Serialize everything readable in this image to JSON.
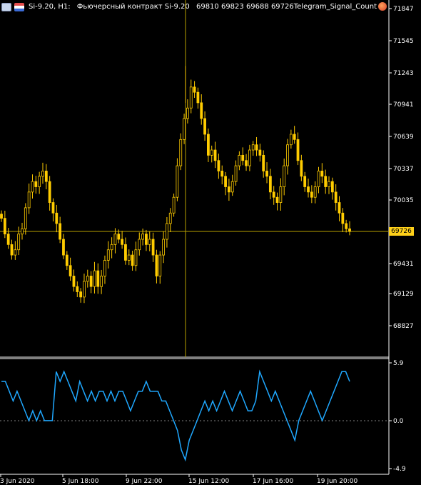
{
  "header": {
    "symbol_timeframe": "Si-9.20, H1:",
    "description": "Фьючерсный контракт Si-9.20",
    "ohlc": "69810 69823 69688 69726"
  },
  "indicator": {
    "label": "Telegram_Signal_Count"
  },
  "price_axis": {
    "labels": [
      "71847",
      "71545",
      "71243",
      "70941",
      "70639",
      "70337",
      "70035",
      "69726",
      "69431",
      "69129",
      "68827"
    ],
    "current_price": "69726"
  },
  "indicator_axis": {
    "labels": [
      "5.9",
      "0.0",
      "-4.9"
    ]
  },
  "time_axis": {
    "labels": [
      "3 Jun 2020",
      "5 Jun 18:00",
      "9 Jun 22:00",
      "15 Jun 12:00",
      "17 Jun 16:00",
      "19 Jun 20:00"
    ]
  },
  "colors": {
    "candles": "#ffcc00",
    "indicator_line": "#1fa8ff",
    "background": "#000000",
    "price_line": "#b8a000"
  },
  "chart_data": [
    {
      "type": "candlestick",
      "title": "Si-9.20, H1",
      "ylim": [
        68700,
        71900
      ],
      "close_series_approx": [
        69850,
        69700,
        69600,
        69500,
        69550,
        69700,
        69750,
        69950,
        70100,
        70200,
        70150,
        70250,
        70300,
        70200,
        70000,
        69900,
        69800,
        69650,
        69500,
        69400,
        69300,
        69200,
        69150,
        69100,
        69250,
        69300,
        69200,
        69350,
        69200,
        69300,
        69450,
        69550,
        69600,
        69700,
        69650,
        69600,
        69450,
        69500,
        69400,
        69550,
        69650,
        69700,
        69600,
        69650,
        69500,
        69300,
        69500,
        69650,
        69800,
        69900,
        70050,
        70350,
        70600,
        70800,
        70900,
        71100,
        71050,
        70950,
        70800,
        70650,
        70450,
        70500,
        70400,
        70300,
        70250,
        70150,
        70100,
        70200,
        70350,
        70450,
        70400,
        70350,
        70500,
        70550,
        70500,
        70450,
        70300,
        70250,
        70100,
        70050,
        70000,
        70150,
        70350,
        70550,
        70650,
        70600,
        70400,
        70250,
        70150,
        70100,
        70050,
        70150,
        70300,
        70250,
        70150,
        70200,
        70100,
        70000,
        69900,
        69800,
        69750,
        69726
      ]
    },
    {
      "type": "line",
      "title": "Telegram_Signal_Count",
      "ylim": [
        -4.9,
        5.9
      ],
      "values_approx": [
        4,
        4,
        3,
        2,
        3,
        2,
        1,
        0,
        1,
        0,
        1,
        0,
        0,
        0,
        5,
        4,
        5,
        4,
        3,
        2,
        4,
        3,
        2,
        3,
        2,
        3,
        3,
        2,
        3,
        2,
        3,
        3,
        2,
        1,
        2,
        3,
        3,
        4,
        3,
        3,
        3,
        2,
        2,
        1,
        0,
        -1,
        -3,
        -4,
        -2,
        -1,
        0,
        1,
        2,
        1,
        2,
        1,
        2,
        3,
        2,
        1,
        2,
        3,
        2,
        1,
        1,
        2,
        5,
        4,
        3,
        2,
        3,
        2,
        1,
        0,
        -1,
        -2,
        0,
        1,
        2,
        3,
        2,
        1,
        0,
        1,
        2,
        3,
        4,
        5,
        5,
        4
      ],
      "zero_line": 0.0
    }
  ]
}
